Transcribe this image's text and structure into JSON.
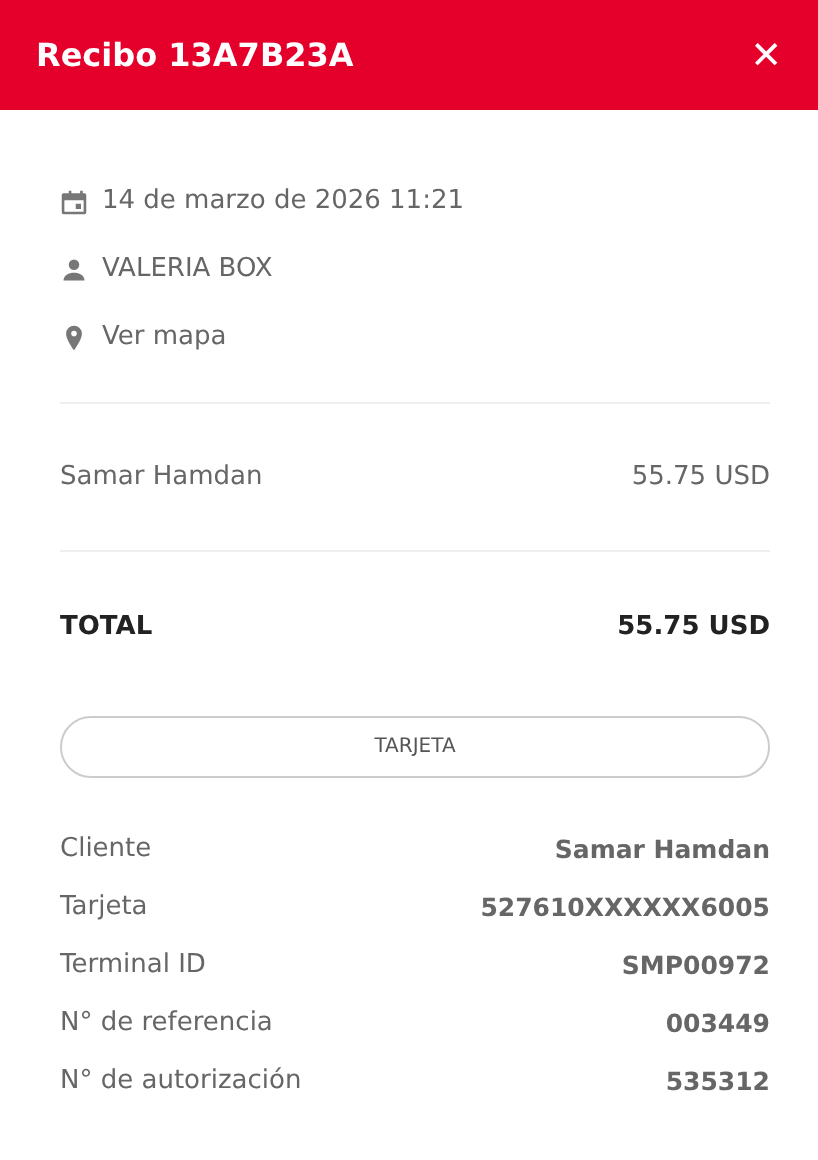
{
  "header": {
    "title": "Recibo 13A7B23A",
    "close": "✕"
  },
  "info": [
    {
      "kind": "date",
      "text": "14 de marzo de 2026 11:21"
    },
    {
      "kind": "user",
      "text": "VALERIA BOX"
    },
    {
      "kind": "location",
      "text": "Ver mapa"
    }
  ],
  "items": [
    {
      "name": "Samar Hamdan",
      "amount": "55.75 USD"
    }
  ],
  "total": {
    "label": "TOTAL",
    "amount": "55.75 USD"
  },
  "payment_button": "TARJETA",
  "details": [
    {
      "label": "Cliente",
      "value": "Samar Hamdan"
    },
    {
      "label": "Tarjeta",
      "value": "527610XXXXXX6005"
    },
    {
      "label": "Terminal ID",
      "value": "SMP00972"
    },
    {
      "label": "N° de referencia",
      "value": "003449"
    },
    {
      "label": "N° de autorización",
      "value": "535312"
    }
  ]
}
